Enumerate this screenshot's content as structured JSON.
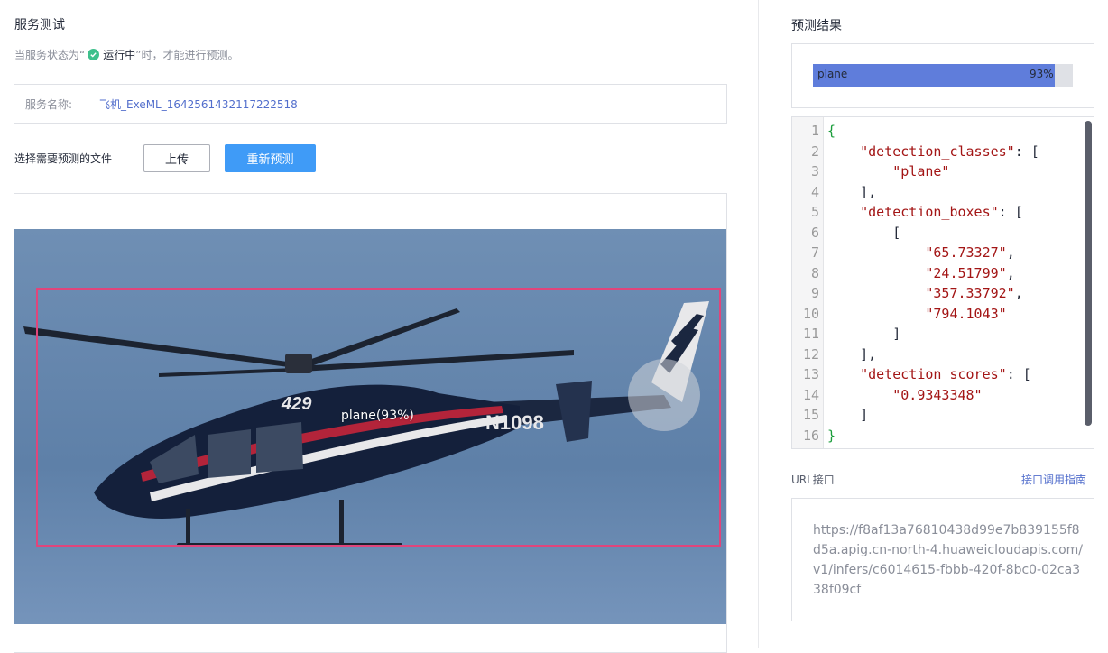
{
  "service_test": {
    "title": "服务测试",
    "hint_prefix": "当服务状态为“",
    "hint_status": "运行中",
    "hint_suffix": "”时，才能进行预测。",
    "service_name_label": "服务名称:",
    "service_name_value": "飞机_ExeML_1642561432117222518",
    "file_label": "选择需要预测的文件",
    "upload_button": "上传",
    "repredict_button": "重新预测",
    "detection_label": "plane(93%)"
  },
  "prediction": {
    "title": "预测结果",
    "bar_label": "plane",
    "bar_percent": "93%",
    "bar_fraction": 0.93,
    "line_numbers": [
      "1",
      "2",
      "3",
      "4",
      "5",
      "6",
      "7",
      "8",
      "9",
      "10",
      "11",
      "12",
      "13",
      "14",
      "15",
      "16"
    ],
    "json_lines": [
      "{",
      "    \"detection_classes\": [",
      "        \"plane\"",
      "    ],",
      "    \"detection_boxes\": [",
      "        [",
      "            \"65.73327\",",
      "            \"24.51799\",",
      "            \"357.33792\",",
      "            \"794.1043\"",
      "        ]",
      "    ],",
      "    \"detection_scores\": [",
      "        \"0.9343348\"",
      "    ]",
      "}"
    ]
  },
  "api": {
    "url_label": "URL接口",
    "guide_link": "接口调用指南",
    "url_value": "https://f8af13a76810438d99e7b839155f8d5a.apig.cn-north-4.huaweicloudapis.com/v1/infers/c6014615-fbbb-420f-8bc0-02ca338f09cf"
  },
  "colors": {
    "accent": "#3f9bf7",
    "bar_fill": "#5f7ddb",
    "detection_box": "#e0457b",
    "status_ok": "#3ec08c",
    "link": "#526ecc"
  },
  "icons": [
    "check-circle-icon"
  ]
}
